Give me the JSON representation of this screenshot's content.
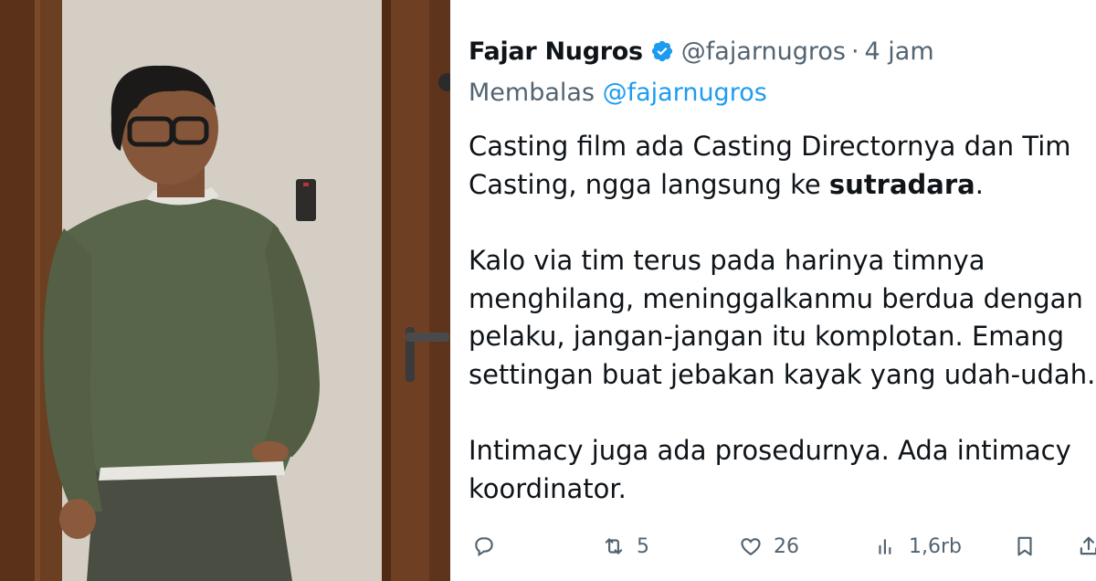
{
  "tweet": {
    "display_name": "Fajar Nugros",
    "handle": "@fajarnugros",
    "separator": "·",
    "time": "4 jam",
    "reply_prefix": "Membalas",
    "reply_handle": "@fajarnugros",
    "lines": [
      "Casting film ada Casting Directornya dan Tim",
      "Casting, ngga langsung ke ",
      "sutradara",
      ".",
      "Kalo via tim terus pada harinya timnya",
      "menghilang, meninggalkanmu berdua dengan",
      "pelaku, jangan-jangan itu komplotan. Emang",
      "settingan buat jebakan kayak yang udah-udah.",
      "Intimacy juga ada prosedurnya. Ada intimacy",
      "koordinator."
    ],
    "retweet_count": "5",
    "like_count": "26",
    "view_count": "1,6rb"
  },
  "icons": {
    "verified": "verified-badge-icon",
    "reply": "reply-icon",
    "retweet": "retweet-icon",
    "like": "heart-icon",
    "views": "views-icon",
    "bookmark": "bookmark-icon",
    "share": "share-icon"
  },
  "colors": {
    "text": "#0f1419",
    "secondary": "#536471",
    "link": "#1d9bf0"
  }
}
